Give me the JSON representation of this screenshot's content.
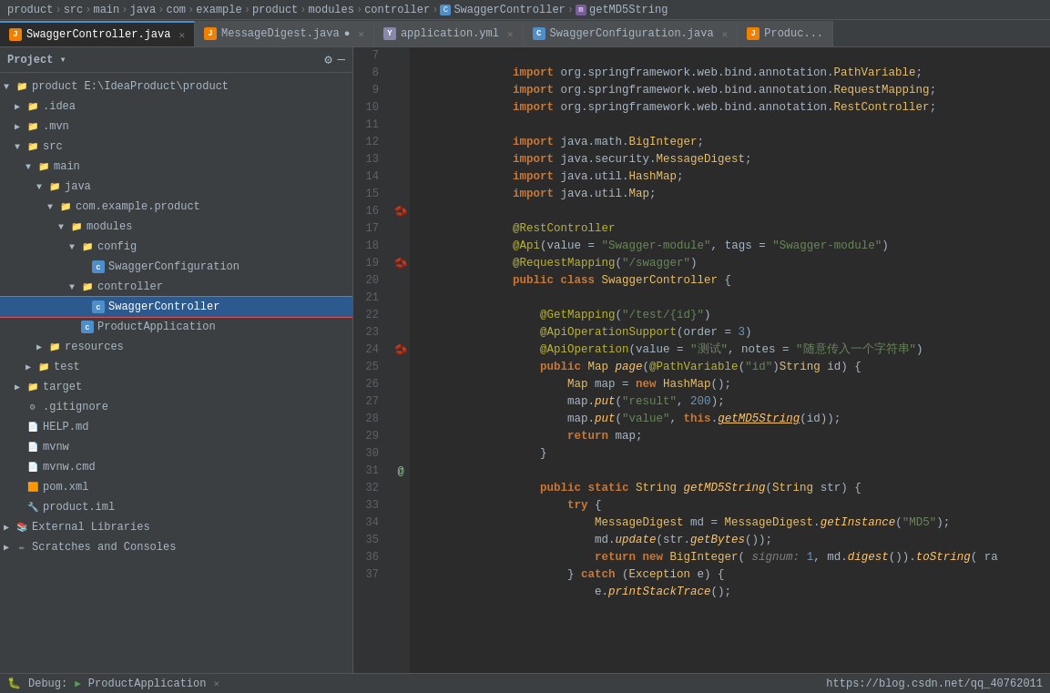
{
  "breadcrumb": {
    "items": [
      "product",
      "src",
      "main",
      "java",
      "com",
      "example",
      "product",
      "modules",
      "controller",
      "SwaggerController",
      "getMD5String"
    ]
  },
  "tabs": [
    {
      "id": "swagger-controller",
      "label": "SwaggerController.java",
      "icon": "java",
      "active": true,
      "modified": false
    },
    {
      "id": "message-digest",
      "label": "MessageDigest.java",
      "icon": "java",
      "active": false,
      "modified": true
    },
    {
      "id": "application-yml",
      "label": "application.yml",
      "icon": "yaml",
      "active": false,
      "modified": false
    },
    {
      "id": "swagger-config",
      "label": "SwaggerConfiguration.java",
      "icon": "config",
      "active": false,
      "modified": false
    },
    {
      "id": "product-app",
      "label": "Produc...",
      "icon": "java",
      "active": false,
      "modified": false
    }
  ],
  "sidebar": {
    "title": "Project",
    "tree": [
      {
        "id": "product-root",
        "label": "product E:\\IdeaProduct\\product",
        "indent": 0,
        "type": "folder-open",
        "expanded": true
      },
      {
        "id": "idea",
        "label": ".idea",
        "indent": 1,
        "type": "folder",
        "expanded": false
      },
      {
        "id": "mvn",
        "label": ".mvn",
        "indent": 1,
        "type": "folder",
        "expanded": false
      },
      {
        "id": "src",
        "label": "src",
        "indent": 1,
        "type": "folder-open",
        "expanded": true
      },
      {
        "id": "main",
        "label": "main",
        "indent": 2,
        "type": "folder-open",
        "expanded": true
      },
      {
        "id": "java",
        "label": "java",
        "indent": 3,
        "type": "folder-open",
        "expanded": true
      },
      {
        "id": "com-example",
        "label": "com.example.product",
        "indent": 4,
        "type": "folder-open",
        "expanded": true
      },
      {
        "id": "modules",
        "label": "modules",
        "indent": 5,
        "type": "folder-open",
        "expanded": true
      },
      {
        "id": "config",
        "label": "config",
        "indent": 6,
        "type": "folder-open",
        "expanded": true
      },
      {
        "id": "swagger-config-file",
        "label": "SwaggerConfiguration",
        "indent": 7,
        "type": "java-class",
        "expanded": false
      },
      {
        "id": "controller",
        "label": "controller",
        "indent": 6,
        "type": "folder-open",
        "expanded": true
      },
      {
        "id": "swagger-controller-file",
        "label": "SwaggerController",
        "indent": 7,
        "type": "java-class",
        "selected": true
      },
      {
        "id": "product-app-file",
        "label": "ProductApplication",
        "indent": 6,
        "type": "java-class",
        "expanded": false
      },
      {
        "id": "resources",
        "label": "resources",
        "indent": 3,
        "type": "folder",
        "expanded": false
      },
      {
        "id": "test",
        "label": "test",
        "indent": 2,
        "type": "folder",
        "expanded": false
      },
      {
        "id": "target",
        "label": "target",
        "indent": 1,
        "type": "folder",
        "expanded": false
      },
      {
        "id": "gitignore",
        "label": ".gitignore",
        "indent": 1,
        "type": "git"
      },
      {
        "id": "help-md",
        "label": "HELP.md",
        "indent": 1,
        "type": "md"
      },
      {
        "id": "mvnw",
        "label": "mvnw",
        "indent": 1,
        "type": "mvnw"
      },
      {
        "id": "mvnw-cmd",
        "label": "mvnw.cmd",
        "indent": 1,
        "type": "mvnw"
      },
      {
        "id": "pom-xml",
        "label": "pom.xml",
        "indent": 1,
        "type": "xml"
      },
      {
        "id": "product-iml",
        "label": "product.iml",
        "indent": 1,
        "type": "iml"
      },
      {
        "id": "external-libs",
        "label": "External Libraries",
        "indent": 0,
        "type": "ext-libs"
      },
      {
        "id": "scratches",
        "label": "Scratches and Consoles",
        "indent": 0,
        "type": "scratch"
      }
    ]
  },
  "code": {
    "lines": [
      {
        "num": 7,
        "gutter": "",
        "content": "    import org.springframework.web.bind.annotation.PathVariable;"
      },
      {
        "num": 8,
        "gutter": "",
        "content": "    import org.springframework.web.bind.annotation.RequestMapping;"
      },
      {
        "num": 9,
        "gutter": "",
        "content": "    import org.springframework.web.bind.annotation.RestController;"
      },
      {
        "num": 10,
        "gutter": "",
        "content": ""
      },
      {
        "num": 11,
        "gutter": "",
        "content": "    import java.math.BigInteger;"
      },
      {
        "num": 12,
        "gutter": "",
        "content": "    import java.security.MessageDigest;"
      },
      {
        "num": 13,
        "gutter": "",
        "content": "    import java.util.HashMap;"
      },
      {
        "num": 14,
        "gutter": "",
        "content": "    import java.util.Map;"
      },
      {
        "num": 15,
        "gutter": "",
        "content": ""
      },
      {
        "num": 16,
        "gutter": "bean",
        "content": "    @RestController"
      },
      {
        "num": 17,
        "gutter": "",
        "content": "    @Api(value = \"Swagger-module\", tags = \"Swagger-module\")"
      },
      {
        "num": 18,
        "gutter": "",
        "content": "    @RequestMapping(\"/swagger\")"
      },
      {
        "num": 19,
        "gutter": "bean",
        "content": "    public class SwaggerController {"
      },
      {
        "num": 20,
        "gutter": "",
        "content": ""
      },
      {
        "num": 21,
        "gutter": "",
        "content": "        @GetMapping(\"/test/{id}\")"
      },
      {
        "num": 22,
        "gutter": "",
        "content": "        @ApiOperationSupport(order = 3)"
      },
      {
        "num": 23,
        "gutter": "",
        "content": "        @ApiOperation(value = \"测试\", notes = \"随意传入一个字符串\")"
      },
      {
        "num": 24,
        "gutter": "bean",
        "content": "        public Map page(@PathVariable(\"id\")String id) {"
      },
      {
        "num": 25,
        "gutter": "",
        "content": "            Map map = new HashMap();"
      },
      {
        "num": 26,
        "gutter": "",
        "content": "            map.put(\"result\", 200);"
      },
      {
        "num": 27,
        "gutter": "",
        "content": "            map.put(\"value\", this.getMD5String(id));"
      },
      {
        "num": 28,
        "gutter": "",
        "content": "            return map;"
      },
      {
        "num": 29,
        "gutter": "",
        "content": "        }"
      },
      {
        "num": 30,
        "gutter": "",
        "content": ""
      },
      {
        "num": 31,
        "gutter": "static",
        "content": "        public static String getMD5String(String str) {"
      },
      {
        "num": 32,
        "gutter": "",
        "content": "            try {"
      },
      {
        "num": 33,
        "gutter": "",
        "content": "                MessageDigest md = MessageDigest.getInstance(\"MD5\");"
      },
      {
        "num": 34,
        "gutter": "",
        "content": "                md.update(str.getBytes());"
      },
      {
        "num": 35,
        "gutter": "",
        "content": "                return new BigInteger( signum: 1, md.digest()).toString( ra"
      },
      {
        "num": 36,
        "gutter": "",
        "content": "            } catch (Exception e) {"
      },
      {
        "num": 37,
        "gutter": "",
        "content": "                e.printStackTrace();"
      }
    ]
  },
  "bottom": {
    "debug_label": "Debug:",
    "app_label": "ProductApplication",
    "url": "https://blog.csdn.net/qq_40762011"
  }
}
